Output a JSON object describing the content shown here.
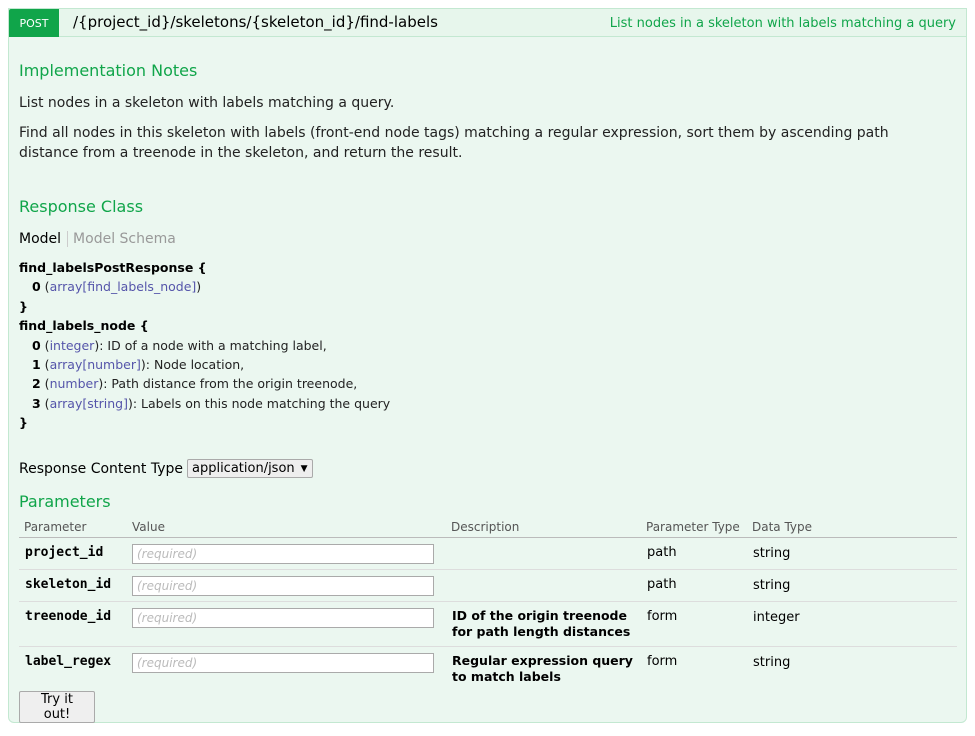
{
  "operation": {
    "method": "POST",
    "path": "/{project_id}/skeletons/{skeleton_id}/find-labels",
    "summary": "List nodes in a skeleton with labels matching a query"
  },
  "implementation_notes": {
    "heading": "Implementation Notes",
    "line1": "List nodes in a skeleton with labels matching a query.",
    "line2": "Find all nodes in this skeleton with labels (front-end node tags) matching a regular expression, sort them by ascending path distance from a treenode in the skeleton, and return the result."
  },
  "response_class": {
    "heading": "Response Class",
    "tab_model": "Model",
    "tab_schema": "Model Schema",
    "models": [
      {
        "name": "find_labelsPostResponse {",
        "fields": [
          {
            "key": "0",
            "type": "array[find_labels_node]",
            "desc": ""
          }
        ]
      },
      {
        "name": "find_labels_node {",
        "fields": [
          {
            "key": "0",
            "type": "integer",
            "desc": ": ID of a node with a matching label,"
          },
          {
            "key": "1",
            "type": "array[number]",
            "desc": ": Node location,"
          },
          {
            "key": "2",
            "type": "number",
            "desc": ": Path distance from the origin treenode,"
          },
          {
            "key": "3",
            "type": "array[string]",
            "desc": ": Labels on this node matching the query"
          }
        ]
      }
    ],
    "close": "}"
  },
  "response_content_type": {
    "label": "Response Content Type",
    "selected": "application/json"
  },
  "parameters": {
    "heading": "Parameters",
    "columns": [
      "Parameter",
      "Value",
      "Description",
      "Parameter Type",
      "Data Type"
    ],
    "rows": [
      {
        "name": "project_id",
        "placeholder": "(required)",
        "description": "",
        "param_type": "path",
        "data_type": "string"
      },
      {
        "name": "skeleton_id",
        "placeholder": "(required)",
        "description": "",
        "param_type": "path",
        "data_type": "string"
      },
      {
        "name": "treenode_id",
        "placeholder": "(required)",
        "description": "ID of the origin treenode for path length distances",
        "param_type": "form",
        "data_type": "integer"
      },
      {
        "name": "label_regex",
        "placeholder": "(required)",
        "description": "Regular expression query to match labels",
        "param_type": "form",
        "data_type": "string"
      }
    ]
  },
  "try_button": "Try it out!"
}
